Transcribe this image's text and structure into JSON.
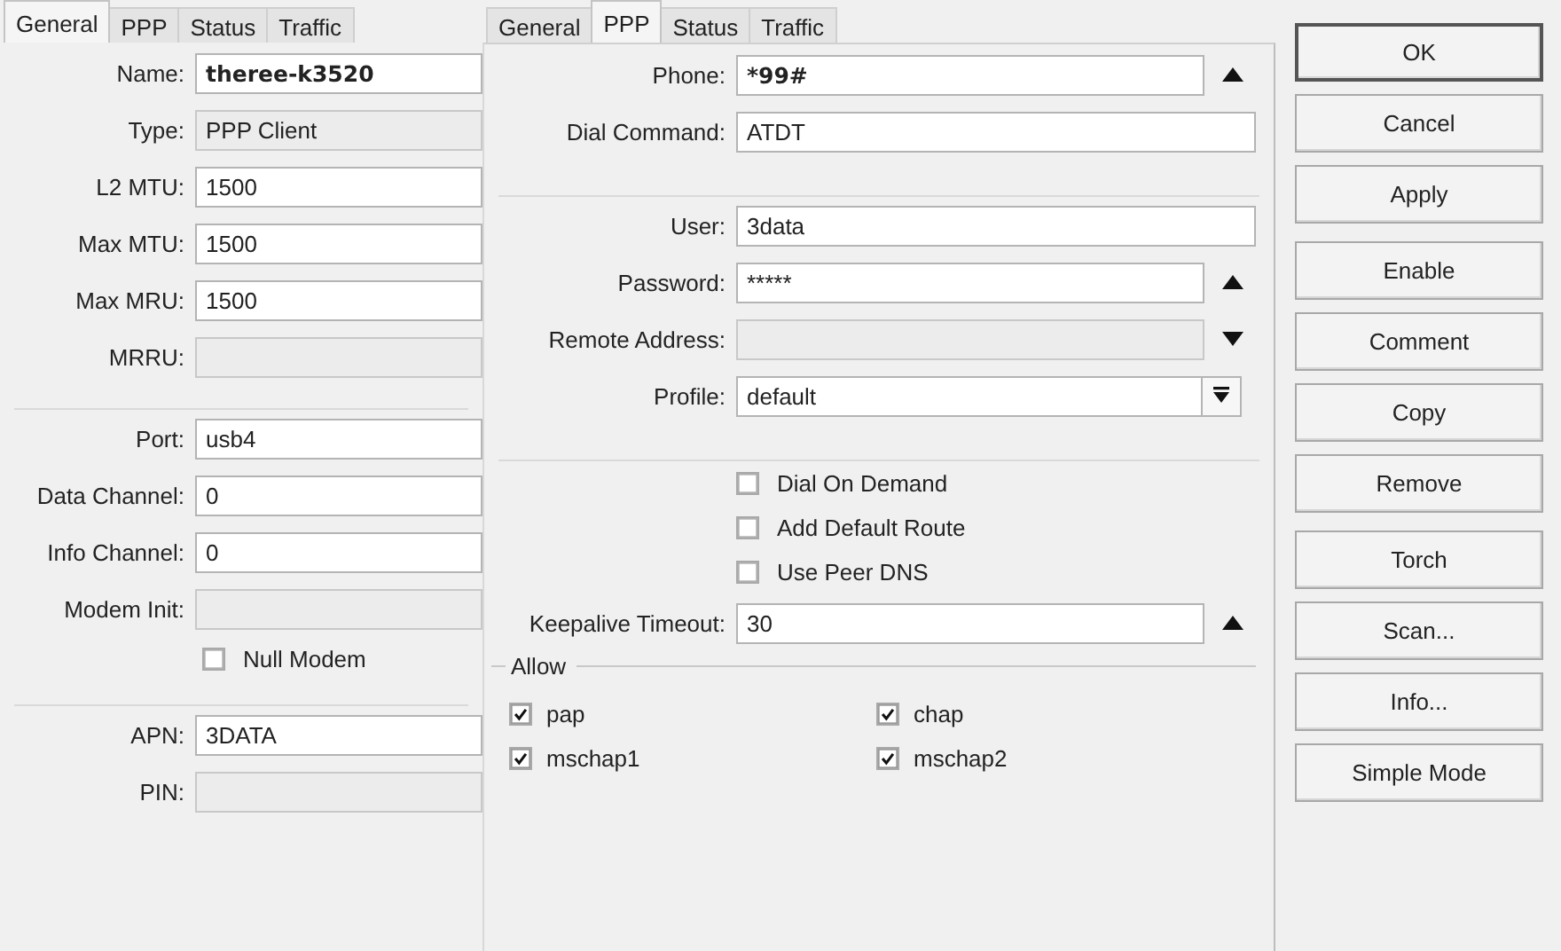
{
  "left_panel": {
    "tabs": [
      {
        "label": "General",
        "selected": true
      },
      {
        "label": "PPP",
        "selected": false
      },
      {
        "label": "Status",
        "selected": false
      },
      {
        "label": "Traffic",
        "selected": false
      }
    ],
    "rows": [
      {
        "kind": "field",
        "label": "Name:",
        "value": "theree-k3520",
        "bold": true,
        "disabled": false
      },
      {
        "kind": "field",
        "label": "Type:",
        "value": "PPP Client",
        "bold": false,
        "disabled": true
      },
      {
        "kind": "field",
        "label": "L2 MTU:",
        "value": "1500",
        "bold": false,
        "disabled": false
      },
      {
        "kind": "field",
        "label": "Max MTU:",
        "value": "1500",
        "bold": false,
        "disabled": false
      },
      {
        "kind": "field",
        "label": "Max MRU:",
        "value": "1500",
        "bold": false,
        "disabled": false
      },
      {
        "kind": "field",
        "label": "MRRU:",
        "bold": false,
        "disabled": true
      },
      {
        "kind": "separator"
      },
      {
        "kind": "field",
        "label": "Port:",
        "value": "usb4",
        "bold": false,
        "disabled": false
      },
      {
        "kind": "field",
        "label": "Data Channel:",
        "value": "0",
        "bold": false,
        "disabled": false
      },
      {
        "kind": "field",
        "label": "Info Channel:",
        "value": "0",
        "bold": false,
        "disabled": false
      },
      {
        "kind": "field",
        "label": "Modem Init:",
        "bold": false,
        "disabled": true
      },
      {
        "kind": "checkbox",
        "label": "Null Modem",
        "checked": false
      },
      {
        "kind": "separator"
      },
      {
        "kind": "field",
        "label": "APN:",
        "value": "3DATA",
        "bold": false,
        "disabled": false
      },
      {
        "kind": "field",
        "label": "PIN:",
        "bold": false,
        "disabled": true
      }
    ]
  },
  "right_panel": {
    "tabs": [
      {
        "label": "General",
        "selected": false
      },
      {
        "label": "PPP",
        "selected": true
      },
      {
        "label": "Status",
        "selected": false
      },
      {
        "label": "Traffic",
        "selected": false
      }
    ],
    "rows": [
      {
        "kind": "field",
        "label": "Phone:",
        "value": "*99#",
        "bold": true,
        "disabled": false,
        "button": {
          "kind": "up"
        }
      },
      {
        "kind": "field",
        "label": "Dial Command:",
        "value": "ATDT",
        "bold": false,
        "disabled": false
      },
      {
        "kind": "separator"
      },
      {
        "kind": "field",
        "label": "User:",
        "value": "3data",
        "bold": false,
        "disabled": false
      },
      {
        "kind": "field",
        "label": "Password:",
        "value": "*****",
        "bold": false,
        "disabled": false,
        "button": {
          "kind": "up"
        }
      },
      {
        "kind": "field",
        "label": "Remote Address:",
        "bold": false,
        "disabled": true,
        "button": {
          "kind": "down"
        }
      },
      {
        "kind": "field",
        "label": "Profile:",
        "value": "default",
        "bold": false,
        "disabled": false,
        "button": {
          "kind": "menu"
        }
      },
      {
        "kind": "separator"
      },
      {
        "kind": "checkbox",
        "label": "Dial On Demand",
        "checked": false
      },
      {
        "kind": "checkbox",
        "label": "Add Default Route",
        "checked": false
      },
      {
        "kind": "checkbox",
        "label": "Use Peer DNS",
        "checked": false
      },
      {
        "kind": "field",
        "label": "Keepalive Timeout:",
        "value": "30",
        "bold": false,
        "disabled": false,
        "button": {
          "kind": "up"
        }
      },
      {
        "kind": "group",
        "title": "Allow",
        "options": [
          {
            "label": "pap",
            "checked": true
          },
          {
            "label": "chap",
            "checked": true
          },
          {
            "label": "mschap1",
            "checked": true
          },
          {
            "label": "mschap2",
            "checked": true
          }
        ]
      }
    ]
  },
  "buttons": [
    [
      {
        "label": "OK",
        "default": true
      },
      {
        "label": "Cancel",
        "default": false
      },
      {
        "label": "Apply",
        "default": false
      }
    ],
    [
      {
        "label": "Enable",
        "default": false
      },
      {
        "label": "Comment",
        "default": false
      },
      {
        "label": "Copy",
        "default": false
      },
      {
        "label": "Remove",
        "default": false
      }
    ],
    [
      {
        "label": "Torch",
        "default": false
      },
      {
        "label": "Scan...",
        "default": false
      },
      {
        "label": "Info...",
        "default": false
      },
      {
        "label": "Simple Mode",
        "default": false
      }
    ]
  ]
}
